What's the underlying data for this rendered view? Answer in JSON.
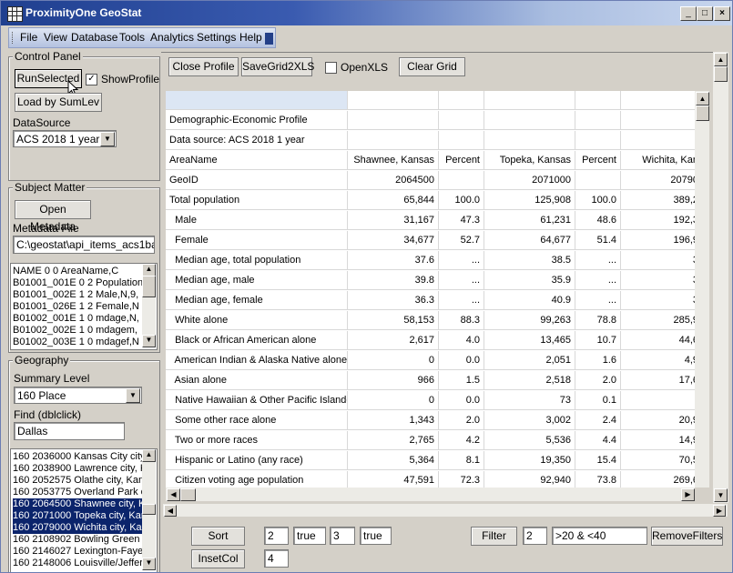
{
  "window": {
    "title": "ProximityOne GeoStat",
    "minimize": "_",
    "maximize": "□",
    "close": "×"
  },
  "menu": [
    "File",
    "View",
    "Database",
    "Tools",
    "Analytics",
    "Settings",
    "Help"
  ],
  "control_panel": {
    "label": "Control Panel",
    "run_selected": "RunSelected",
    "show_profile_label": "ShowProfile",
    "show_profile_checked": "✓",
    "load_by_sumlev": "Load by SumLev",
    "datasource_label": "DataSource",
    "datasource_value": "ACS 2018 1 year"
  },
  "subject_matter": {
    "label": "Subject Matter",
    "open_metadata": "Open Metadata",
    "metadata_file_label": "Metadata File",
    "metadata_file_value": "C:\\geostat\\api_items_acs1base",
    "items": [
      "NAME       0   0 AreaName,C",
      "B01001_001E  0   2 Population",
      "B01001_002E  1   2 Male,N,9,",
      "B01001_026E  1   2 Female,N",
      "B01002_001E  1   0 mdage,N,",
      "B01002_002E  1   0 mdagem,",
      "B01002_003E  1   0 mdagef,N"
    ]
  },
  "geography": {
    "label": "Geography",
    "summary_level_label": "Summary Level",
    "summary_level_value": "160 Place",
    "find_label": "Find (dblclick)",
    "find_value": "Dallas",
    "items": [
      {
        "text": "160 2036000 Kansas City city",
        "selected": false
      },
      {
        "text": "160 2038900 Lawrence city, K",
        "selected": false
      },
      {
        "text": "160 2052575 Olathe city, Kan",
        "selected": false
      },
      {
        "text": "160 2053775 Overland Park c",
        "selected": false
      },
      {
        "text": "160 2064500 Shawnee city, K",
        "selected": true
      },
      {
        "text": "160 2071000 Topeka city, Kar",
        "selected": true
      },
      {
        "text": "160 2079000 Wichita city, Kan",
        "selected": true
      },
      {
        "text": "160 2108902 Bowling Green c",
        "selected": false
      },
      {
        "text": "160 2146027 Lexington-Faye",
        "selected": false
      },
      {
        "text": "160 2148006 Louisville/Jeffer",
        "selected": false
      }
    ]
  },
  "toolbar": {
    "close_profile": "Close Profile",
    "save_grid": "SaveGrid2XLS",
    "open_xls": "OpenXLS",
    "clear_grid": "Clear Grid"
  },
  "grid": {
    "columns": [
      "",
      "Shawnee, Kansas",
      "Percent",
      "Topeka, Kansas",
      "Percent",
      "Wichita, Kan"
    ],
    "rows": [
      [
        "",
        "",
        "",
        "",
        "",
        ""
      ],
      [
        "Demographic-Economic Profile",
        "",
        "",
        "",
        "",
        ""
      ],
      [
        "Data source: ACS 2018 1 year",
        "",
        "",
        "",
        "",
        ""
      ],
      [
        "AreaName",
        "Shawnee, Kansas",
        "Percent",
        "Topeka, Kansas",
        "Percent",
        "Wichita, Kan"
      ],
      [
        "GeoID",
        "2064500",
        "",
        "2071000",
        "",
        "20790"
      ],
      [
        "Total population",
        "65,844",
        "100.0",
        "125,908",
        "100.0",
        "389,2"
      ],
      [
        "  Male",
        "31,167",
        "47.3",
        "61,231",
        "48.6",
        "192,3"
      ],
      [
        "  Female",
        "34,677",
        "52.7",
        "64,677",
        "51.4",
        "196,9"
      ],
      [
        "  Median age, total population",
        "37.6",
        "...",
        "38.5",
        "...",
        "3"
      ],
      [
        "  Median age, male",
        "39.8",
        "...",
        "35.9",
        "...",
        "3"
      ],
      [
        "  Median age, female",
        "36.3",
        "...",
        "40.9",
        "...",
        "3"
      ],
      [
        "  White alone",
        "58,153",
        "88.3",
        "99,263",
        "78.8",
        "285,9"
      ],
      [
        "  Black or African American alone",
        "2,617",
        "4.0",
        "13,465",
        "10.7",
        "44,6"
      ],
      [
        "  American Indian & Alaska Native alone",
        "0",
        "0.0",
        "2,051",
        "1.6",
        "4,9"
      ],
      [
        "  Asian alone",
        "966",
        "1.5",
        "2,518",
        "2.0",
        "17,6"
      ],
      [
        "  Native Hawaiian & Other Pacific Islander",
        "0",
        "0.0",
        "73",
        "0.1",
        ""
      ],
      [
        "  Some other race alone",
        "1,343",
        "2.0",
        "3,002",
        "2.4",
        "20,9"
      ],
      [
        "  Two or more races",
        "2,765",
        "4.2",
        "5,536",
        "4.4",
        "14,9"
      ],
      [
        "  Hispanic or Latino (any race)",
        "5,364",
        "8.1",
        "19,350",
        "15.4",
        "70,5"
      ],
      [
        "  Citizen voting age population",
        "47,591",
        "72.3",
        "92,940",
        "73.8",
        "269,6"
      ]
    ]
  },
  "bottom": {
    "sort": "Sort",
    "sort_v1": "2",
    "sort_v2": "true",
    "sort_v3": "3",
    "sort_v4": "true",
    "insetcol": "InsetCol",
    "insetcol_v": "4",
    "filter": "Filter",
    "filter_col": "2",
    "filter_expr": ">20 & <40",
    "remove_filters": "RemoveFilters"
  },
  "colors": {
    "selection": "#0b246b",
    "title_gradient_start": "#1f3f8f"
  }
}
